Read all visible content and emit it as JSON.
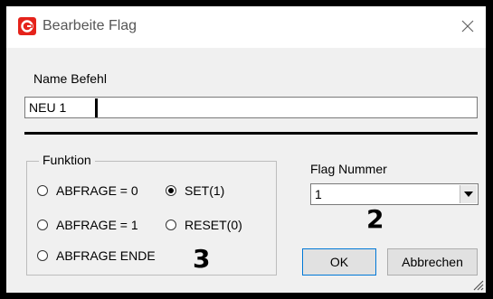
{
  "window": {
    "title": "Bearbeite Flag",
    "icon": "app-logo-icon",
    "close_icon": "close-icon"
  },
  "name_field": {
    "label": "Name Befehl",
    "value": "NEU 1"
  },
  "funktion": {
    "legend": "Funktion",
    "options": [
      {
        "label": "ABFRAGE = 0",
        "selected": false
      },
      {
        "label": "SET(1)",
        "selected": true
      },
      {
        "label": "ABFRAGE = 1",
        "selected": false
      },
      {
        "label": "RESET(0)",
        "selected": false
      },
      {
        "label": "ABFRAGE ENDE",
        "selected": false
      }
    ],
    "annotation": "3"
  },
  "flag_nummer": {
    "label": "Flag Nummer",
    "selected": "1",
    "annotation": "2"
  },
  "buttons": {
    "ok": "OK",
    "cancel": "Abbrechen"
  },
  "colors": {
    "app_icon": "#e5231b",
    "ok_border": "#0078d7"
  }
}
